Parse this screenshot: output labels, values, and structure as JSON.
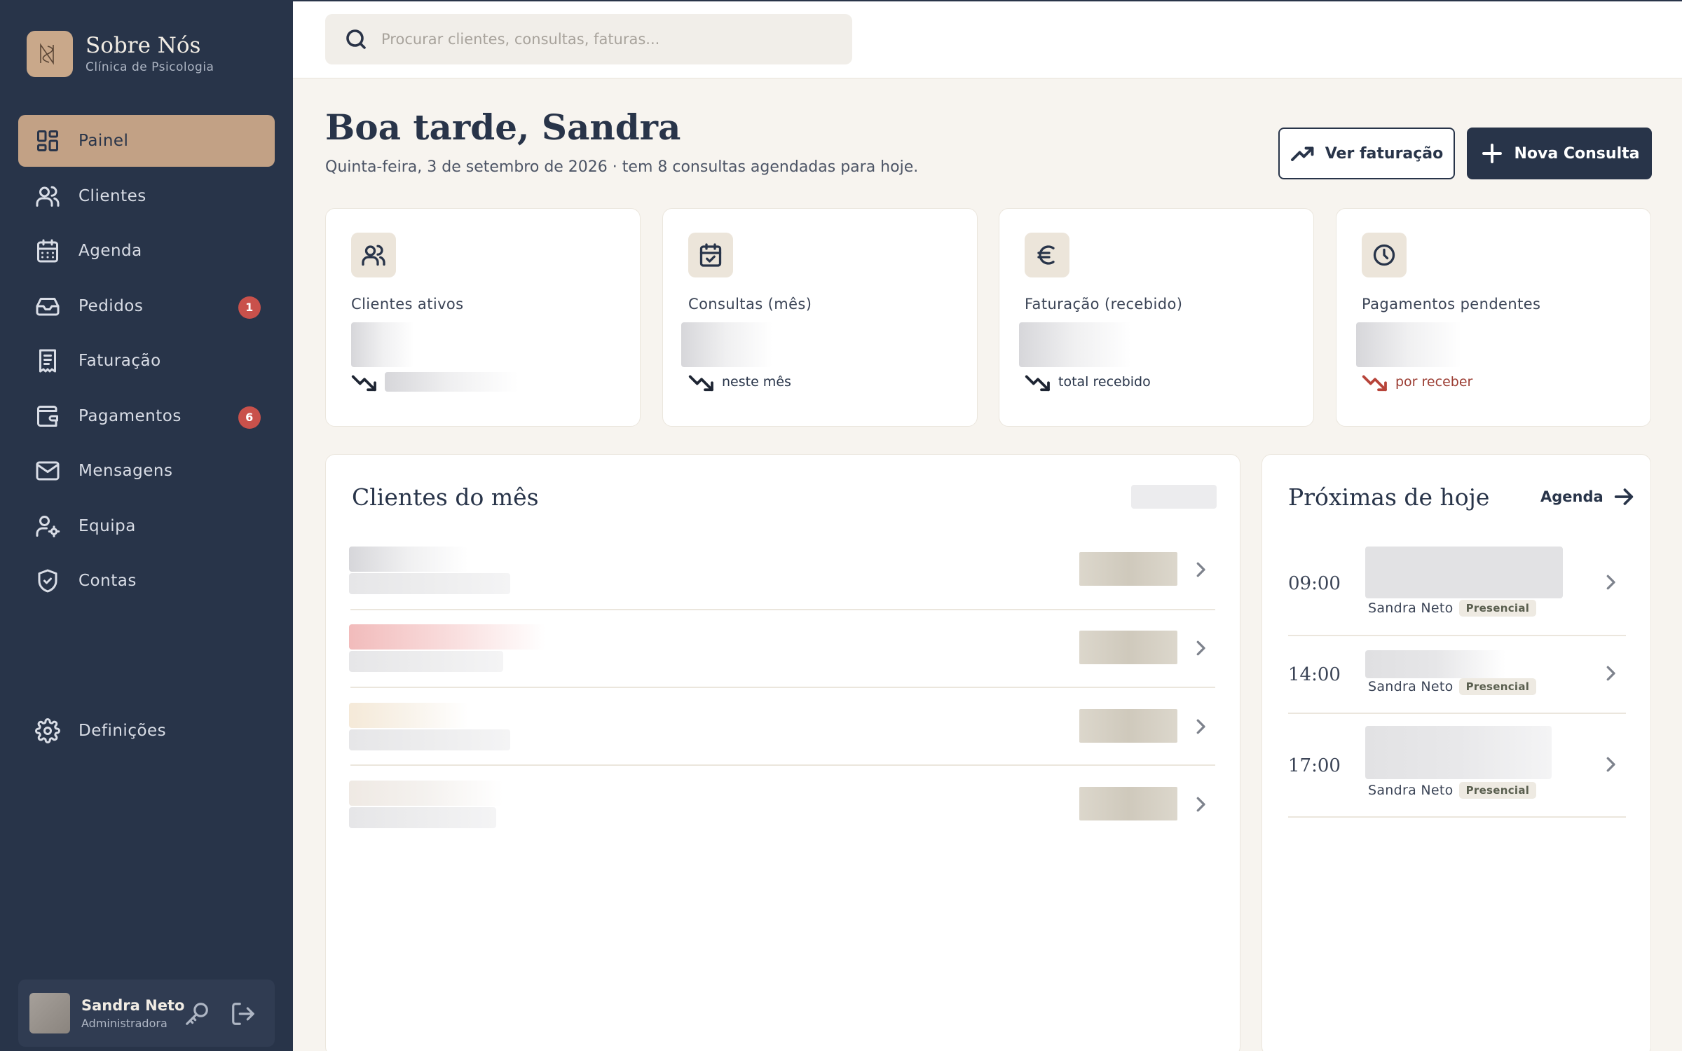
{
  "brand": {
    "name": "Sobre Nós",
    "subtitle": "Clínica de Psicologia"
  },
  "sidebar": {
    "items": [
      {
        "label": "Painel",
        "icon": "grid-icon",
        "active": true
      },
      {
        "label": "Clientes",
        "icon": "users-icon"
      },
      {
        "label": "Agenda",
        "icon": "calendar-icon"
      },
      {
        "label": "Pedidos",
        "icon": "inbox-icon",
        "badge": "1"
      },
      {
        "label": "Faturação",
        "icon": "receipt-icon"
      },
      {
        "label": "Pagamentos",
        "icon": "wallet-icon",
        "badge": "6"
      },
      {
        "label": "Mensagens",
        "icon": "mail-icon"
      },
      {
        "label": "Equipa",
        "icon": "user-cog-icon"
      },
      {
        "label": "Contas",
        "icon": "shield-check-icon"
      }
    ],
    "settings": {
      "label": "Definições",
      "icon": "gear-icon"
    }
  },
  "user": {
    "name": "Sandra Neto",
    "role": "Administradora"
  },
  "search": {
    "placeholder": "Procurar clientes, consultas, faturas..."
  },
  "header": {
    "greeting": "Boa tarde, Sandra",
    "subtitle": "Quinta-feira, 3 de setembro de 2026 · tem 8 consultas agendadas para hoje.",
    "btn_billing": "Ver faturação",
    "btn_new": "Nova Consulta"
  },
  "stats": [
    {
      "label": "Clientes ativos",
      "trend": "",
      "icon": "users-icon"
    },
    {
      "label": "Consultas (mês)",
      "trend": "neste mês",
      "icon": "calendar-check-icon"
    },
    {
      "label": "Faturação (recebido)",
      "trend": "total recebido",
      "icon": "euro-icon"
    },
    {
      "label": "Pagamentos pendentes",
      "trend": "por receber",
      "icon": "clock-icon"
    }
  ],
  "clients_panel": {
    "title": "Clientes do mês"
  },
  "upcoming": {
    "title": "Próximas de hoje",
    "link": "Agenda",
    "items": [
      {
        "time": "09:00",
        "who": "Sandra Neto",
        "tag": "Presencial"
      },
      {
        "time": "14:00",
        "who": "Sandra Neto",
        "tag": "Presencial"
      },
      {
        "time": "17:00",
        "who": "Sandra Neto",
        "tag": "Presencial"
      }
    ]
  },
  "colors": {
    "sidebar": "#283449",
    "accent": "#c2a185",
    "badge": "#c9514b",
    "background": "#f7f4ef"
  }
}
